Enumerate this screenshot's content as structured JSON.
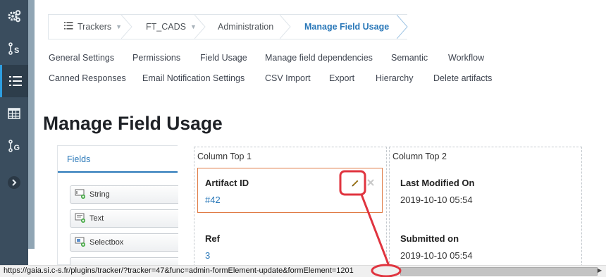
{
  "sidebar": {
    "items": [
      {
        "icon": "gears-icon"
      },
      {
        "icon": "git-icon"
      },
      {
        "icon": "tracker-list-icon"
      },
      {
        "icon": "table-icon"
      },
      {
        "icon": "git-g-icon"
      },
      {
        "icon": "chevron-right-icon"
      }
    ]
  },
  "breadcrumb": {
    "items": [
      {
        "label": "Trackers"
      },
      {
        "label": "FT_CADS"
      },
      {
        "label": "Administration"
      },
      {
        "label": "Manage Field Usage"
      }
    ]
  },
  "tabs": {
    "row1": [
      "General Settings",
      "Permissions",
      "Field Usage",
      "Manage field dependencies",
      "Semantic",
      "Workflow"
    ],
    "row2": [
      "Canned Responses",
      "Email Notification Settings",
      "CSV Import",
      "Export",
      "Hierarchy",
      "Delete artifacts"
    ]
  },
  "page_title": "Manage Field Usage",
  "palette": {
    "header": "Fields",
    "items": [
      {
        "label": "String",
        "icon": "string-field-icon"
      },
      {
        "label": "Text",
        "icon": "text-field-icon"
      },
      {
        "label": "Selectbox",
        "icon": "selectbox-field-icon"
      }
    ]
  },
  "columns": [
    {
      "title": "Column Top 1",
      "fields": [
        {
          "label": "Artifact ID",
          "value": "#42"
        },
        {
          "label": "Ref",
          "value": "3"
        }
      ]
    },
    {
      "title": "Column Top 2",
      "fields": [
        {
          "label": "Last Modified On",
          "value": "2019-10-10 05:54"
        },
        {
          "label": "Submitted on",
          "value": "2019-10-10 05:54"
        }
      ]
    }
  ],
  "status_bar": {
    "url": "https://gaia.si.c-s.fr/plugins/tracker/?tracker=47&func=admin-formElement-update&formElement=1201"
  },
  "colors": {
    "sidebar": "#3a4d5e",
    "accent": "#2a78b9",
    "selection": "#e07b45",
    "annotation": "#e0343f"
  }
}
